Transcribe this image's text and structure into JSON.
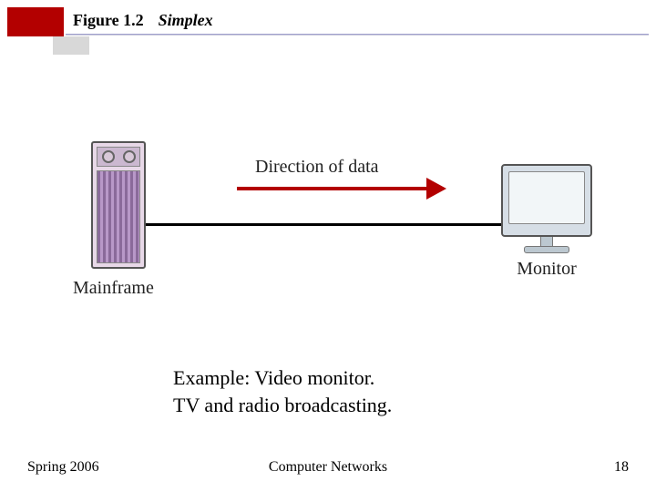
{
  "header": {
    "figure_label": "Figure 1.2",
    "figure_name": "Simplex"
  },
  "diagram": {
    "left_device_label": "Mainframe",
    "right_device_label": "Monitor",
    "arrow_label": "Direction of data"
  },
  "example": {
    "line1": "Example: Video monitor.",
    "line2": "TV and radio broadcasting."
  },
  "footer": {
    "left": "Spring 2006",
    "center": "Computer Networks",
    "right": "18"
  }
}
